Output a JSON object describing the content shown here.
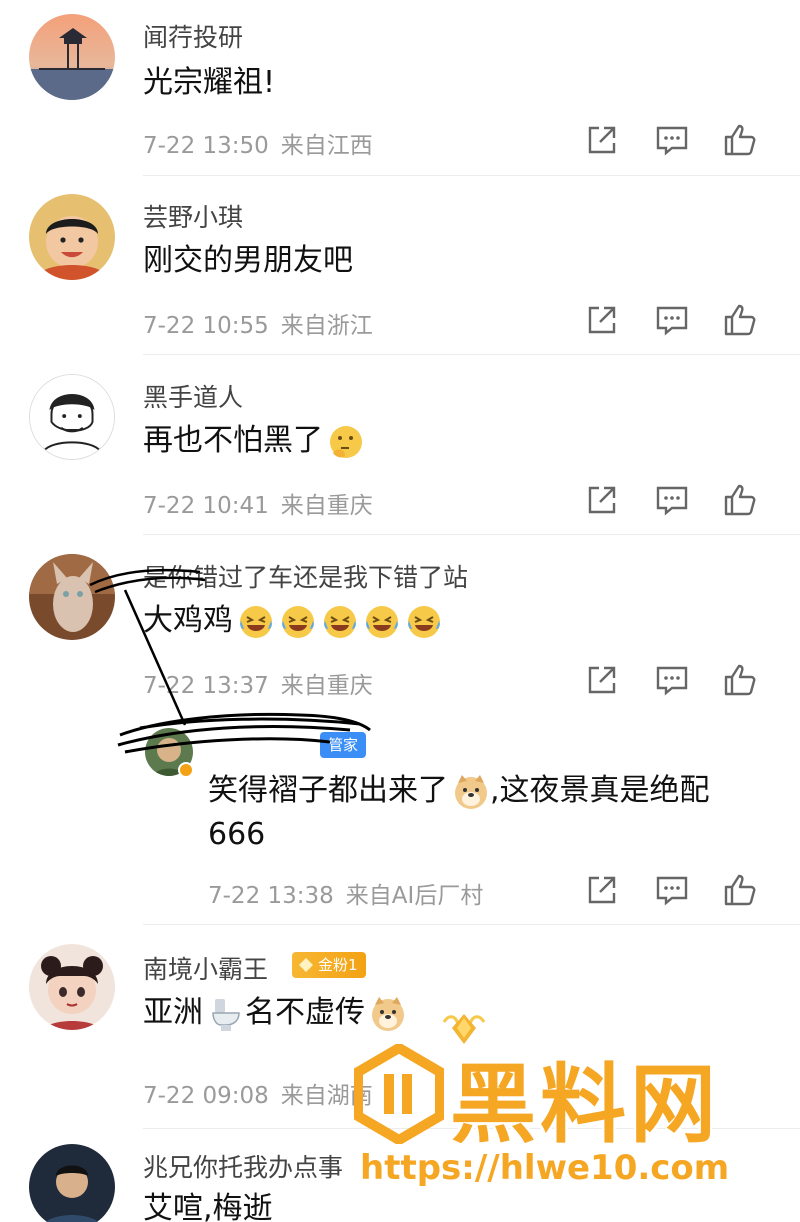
{
  "comments": [
    {
      "name": "闻荇投研",
      "text": "光宗耀祖!",
      "date": "7-22 13:50",
      "location": "来自江西"
    },
    {
      "name": "芸野小琪",
      "text": "刚交的男朋友吧",
      "date": "7-22 10:55",
      "location": "来自浙江"
    },
    {
      "name": "黑手道人",
      "text": "再也不怕黑了",
      "date": "7-22 10:41",
      "location": "来自重庆",
      "emoji": "thinking-face"
    },
    {
      "name": "是你错过了车还是我下错了站",
      "text": "大鸡鸡",
      "date": "7-22 13:37",
      "location": "来自重庆",
      "emoji": "laughing-crying-face x5"
    },
    {
      "name": "",
      "badge": "管家",
      "text_line1": "笑得褶子都出来了",
      "text_line1_after": ",这夜景真是绝配",
      "text_line2": "666",
      "date": "7-22 13:38",
      "location": "来自AI后厂村",
      "emoji": "doge-face"
    },
    {
      "name": "南境小霸王",
      "badge": "金粉1",
      "text_before": "亚洲",
      "text_after": "名不虚传",
      "date": "7-22 09:08",
      "location": "来自湖南",
      "emoji": "toilet, doge-face"
    },
    {
      "name": "兆兄你托我办点事",
      "text": "艾喧,梅逝"
    }
  ],
  "action_icons": [
    "share-icon",
    "comment-icon",
    "like-icon"
  ],
  "watermark": {
    "title": "黑料网",
    "url": "https://hlwe10.com"
  },
  "colors": {
    "meta_text": "#9a9a9a",
    "watermark": "#f5a623",
    "badge_gold": "#f3a213",
    "badge_blue": "#3a8ef6"
  }
}
